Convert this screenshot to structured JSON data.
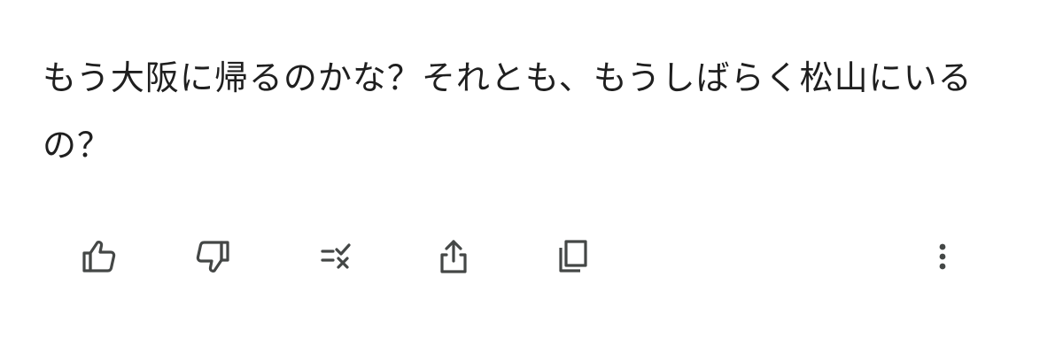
{
  "response": {
    "text": "もう大阪に帰るのかな？それとも、もうしばらく松山にいるの？"
  },
  "actions": [
    {
      "name": "thumb-up",
      "icon": "thumb-up-icon"
    },
    {
      "name": "thumb-down",
      "icon": "thumb-down-icon"
    },
    {
      "name": "modify-response",
      "icon": "list-check-x-icon"
    },
    {
      "name": "share",
      "icon": "share-icon"
    },
    {
      "name": "copy",
      "icon": "copy-icon"
    },
    {
      "name": "more",
      "icon": "more-vertical-icon"
    }
  ],
  "colors": {
    "text": "#1f1f1f",
    "icon": "#444746",
    "background": "#ffffff"
  }
}
